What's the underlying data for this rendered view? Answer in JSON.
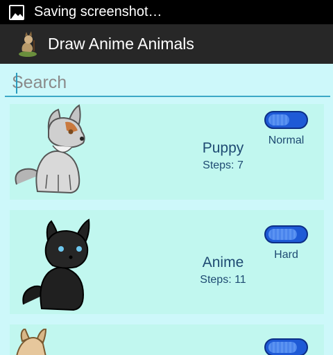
{
  "status_bar": {
    "text": "Saving screenshot…"
  },
  "action_bar": {
    "title": "Draw Anime Animals"
  },
  "search": {
    "placeholder": "Search",
    "value": ""
  },
  "lessons": [
    {
      "name": "Puppy",
      "steps": "Steps: 7",
      "difficulty": "Normal",
      "difficulty_level": 0.55,
      "image": "grey-wolf-pup"
    },
    {
      "name": "Anime",
      "steps": "Steps: 11",
      "difficulty": "Hard",
      "difficulty_level": 0.75,
      "image": "black-wolf-pup"
    },
    {
      "name": "",
      "steps": "",
      "difficulty": "",
      "difficulty_level": 0.75,
      "image": "tan-animal"
    }
  ]
}
